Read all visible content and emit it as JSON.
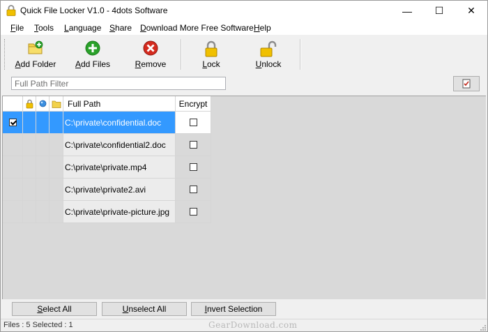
{
  "window": {
    "title": "Quick File Locker V1.0 - 4dots Software",
    "controls": {
      "minimize": "—",
      "maximize": "☐",
      "close": "✕"
    }
  },
  "menu": {
    "items": [
      "File",
      "Tools",
      "Language",
      "Share",
      "Download More Free Software",
      "Help"
    ]
  },
  "toolbar": {
    "add_folder": "Add Folder",
    "add_files": "Add Files",
    "remove": "Remove",
    "lock": "Lock",
    "unlock": "Unlock"
  },
  "filter": {
    "placeholder": "Full Path Filter",
    "value": ""
  },
  "grid": {
    "columns": [
      "",
      "lock-icon",
      "status-icon",
      "folder-icon",
      "Full Path",
      "Encrypt"
    ],
    "header_full_path": "Full Path",
    "header_encrypt": "Encrypt",
    "rows": [
      {
        "checked": true,
        "path": "C:\\private\\confidential.doc",
        "encrypt": false,
        "selected": true
      },
      {
        "checked": false,
        "path": "C:\\private\\confidential2.doc",
        "encrypt": false,
        "selected": false
      },
      {
        "checked": false,
        "path": "C:\\private\\private.mp4",
        "encrypt": false,
        "selected": false
      },
      {
        "checked": false,
        "path": "C:\\private\\private2.avi",
        "encrypt": false,
        "selected": false
      },
      {
        "checked": false,
        "path": "C:\\private\\private-picture.jpg",
        "encrypt": false,
        "selected": false
      }
    ]
  },
  "bottom": {
    "select_all": "Select All",
    "unselect_all": "Unselect All",
    "invert_selection": "Invert Selection"
  },
  "status": {
    "text": "Files : 5  Selected : 1",
    "watermark": "GearDownload.com"
  },
  "colors": {
    "selection": "#3399ff",
    "grid_background": "#d9d9d9",
    "lock_gold": "#e8b400",
    "add_green": "#2aa12a",
    "remove_red": "#d42a1e"
  }
}
